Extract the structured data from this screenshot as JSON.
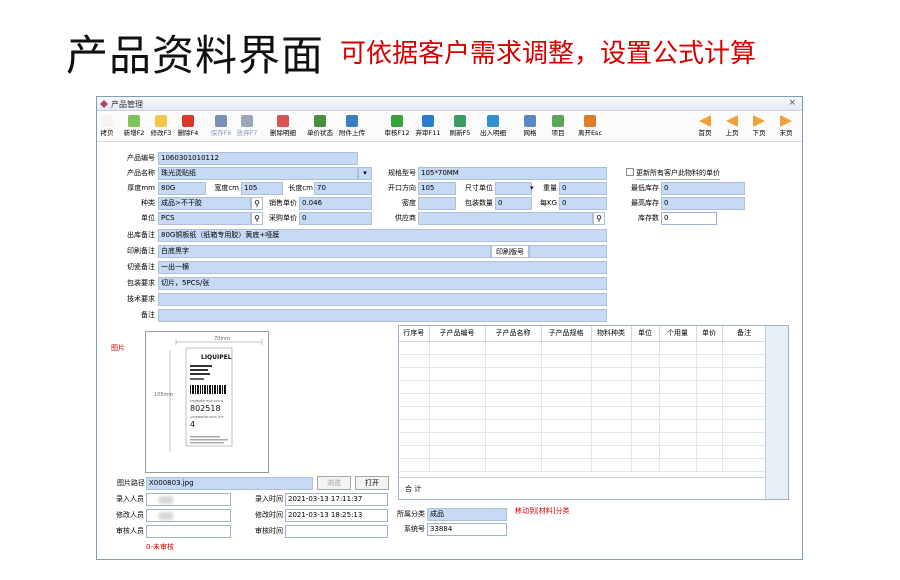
{
  "headline": "产品资料界面",
  "subline": "可依据客户需求调整，设置公式计算",
  "window": {
    "title": "产品管理",
    "close": "×"
  },
  "toolbar": [
    {
      "key": "copy",
      "label": "拷贝",
      "icon": "copy-icon",
      "color": "#f4f4f4"
    },
    {
      "key": "new",
      "label": "新增F2",
      "icon": "new-icon",
      "color": "#7cc35a"
    },
    {
      "key": "edit",
      "label": "修改F3",
      "icon": "edit-icon",
      "color": "#f2c94c"
    },
    {
      "key": "delete",
      "label": "删除F4",
      "icon": "delete-icon",
      "color": "#d93a2b"
    },
    {
      "key": "save",
      "label": "保存F6",
      "icon": "save-icon",
      "color": "#7a8fb5",
      "disabled": true
    },
    {
      "key": "cancel",
      "label": "放弃F7",
      "icon": "undo-icon",
      "color": "#9aa6b8",
      "disabled": true
    },
    {
      "key": "del-detail",
      "label": "删除明细",
      "icon": "delete-detail-icon",
      "color": "#d9534f"
    },
    {
      "key": "price-status",
      "label": "单价状态",
      "icon": "price-status-icon",
      "color": "#4a8f3c"
    },
    {
      "key": "attach",
      "label": "附件上传",
      "icon": "upload-globe-icon",
      "color": "#3a7fc1"
    },
    {
      "key": "audit",
      "label": "审核F12",
      "icon": "checkmark-icon",
      "color": "#3aa23a"
    },
    {
      "key": "unaudit",
      "label": "弃审F11",
      "icon": "refresh-icon",
      "color": "#2b7bd1"
    },
    {
      "key": "refresh",
      "label": "刷新F5",
      "icon": "refresh-dollar-icon",
      "color": "#3b9b63"
    },
    {
      "key": "io-detail",
      "label": "出入明细",
      "icon": "transfer-icon",
      "color": "#2f8fcf"
    },
    {
      "key": "grid",
      "label": "网格",
      "icon": "grid-icon",
      "color": "#5c86c4"
    },
    {
      "key": "item",
      "label": "项目",
      "icon": "project-icon",
      "color": "#5aa55a"
    },
    {
      "key": "exit",
      "label": "离开Esc",
      "icon": "exit-door-icon",
      "color": "#e07b2a"
    }
  ],
  "nav": [
    {
      "key": "first",
      "label": "首页",
      "icon": "first-page-icon"
    },
    {
      "key": "prev",
      "label": "上页",
      "icon": "prev-page-icon"
    },
    {
      "key": "next",
      "label": "下页",
      "icon": "next-page-icon"
    },
    {
      "key": "last",
      "label": "末页",
      "icon": "last-page-icon"
    }
  ],
  "form": {
    "product_code_label": "产品编号",
    "product_code": "1060301010112",
    "product_name_label": "产品名称",
    "product_name": "珠光烫贴纸",
    "thickness_label": "厚度mm",
    "thickness": "80G",
    "width_label": "宽度cm",
    "width": "105",
    "length_label": "长度cm",
    "length": "70",
    "type_label": "种类",
    "type": "成品>不干胶",
    "sale_price_label": "销售单价",
    "sale_price": "0.046",
    "unit_label": "单位",
    "unit": "PCS",
    "purchase_price_label": "采购单价",
    "purchase_price": "0",
    "spec_label": "规格型号",
    "spec": "105*70MM",
    "opening_label": "开口方向",
    "opening": "105",
    "size_unit_label": "尺寸单位",
    "size_unit": "",
    "weight_label": "重量",
    "weight": "0",
    "density_label": "密度",
    "density": "",
    "pack_qty_label": "包装数量",
    "pack_qty": "0",
    "per_kg_label": "每KG",
    "per_kg": "0",
    "supplier_label": "供应商",
    "supplier": "",
    "update_price_label": "更新所有客户此物料的单价",
    "min_stock_label": "最低库存",
    "min_stock": "0",
    "max_stock_label": "最高库存",
    "max_stock": "0",
    "stock_qty_label": "库存数",
    "stock_qty": "0",
    "issue_note_label": "出库备注",
    "issue_note": "80G铜板纸（纸箱专用胶）黄底+哑膜",
    "print_note_label": "印刷备注",
    "print_note": "白底黑字",
    "print_version_label": "印刷版号",
    "print_version": "",
    "cut_note_label": "切瓷备注",
    "cut_note": "一出一横",
    "pack_req_label": "包装要求",
    "pack_req": "切片，5PCS/张",
    "tech_req_label": "技术要求",
    "tech_req": "",
    "remark_label": "备注",
    "remark": ""
  },
  "image_section": {
    "label": "图片"
  },
  "label_sample": {
    "dim_top": "70mm",
    "dim_left": "105mm",
    "brand": "LIQUIPEL",
    "lines": [
      "POWERTEK",
      "Batch Code",
      "MFG DATE",
      "BARCODE"
    ],
    "serial_label": "SHIPMENT BOX/ASN #",
    "serial": "802518",
    "qty_label": "ASSEMBLED PACK QTY",
    "qty": "4"
  },
  "picture_path_label": "图片路径",
  "picture_path": "X000803.jpg",
  "browse_label": "浏览",
  "open_label": "打开",
  "grid": {
    "columns": [
      "行序号",
      "子产品编号",
      "子产品名称",
      "子产品规格",
      "物料种类",
      "单位",
      "个用量",
      "单价",
      "备注"
    ],
    "total_label": "合 计"
  },
  "footer": {
    "entered_by_label": "录入人员",
    "entered_time_label": "录入时间",
    "entered_time": "2021-03-13 17:11:37",
    "modified_by_label": "修改人员",
    "modified_time_label": "修改时间",
    "modified_time": "2021-03-13 18:25:13",
    "auditor_label": "审核人员",
    "audit_time_label": "审核时间",
    "audit_time": "",
    "audit_status": "0-未审核",
    "category_label": "所属分类",
    "category": "成品",
    "move_link": "移动到[材料]分类",
    "system_no_label": "系统号",
    "system_no": "33884"
  },
  "colors": {
    "field": "#c7daf5",
    "accent_red": "#d40000"
  }
}
